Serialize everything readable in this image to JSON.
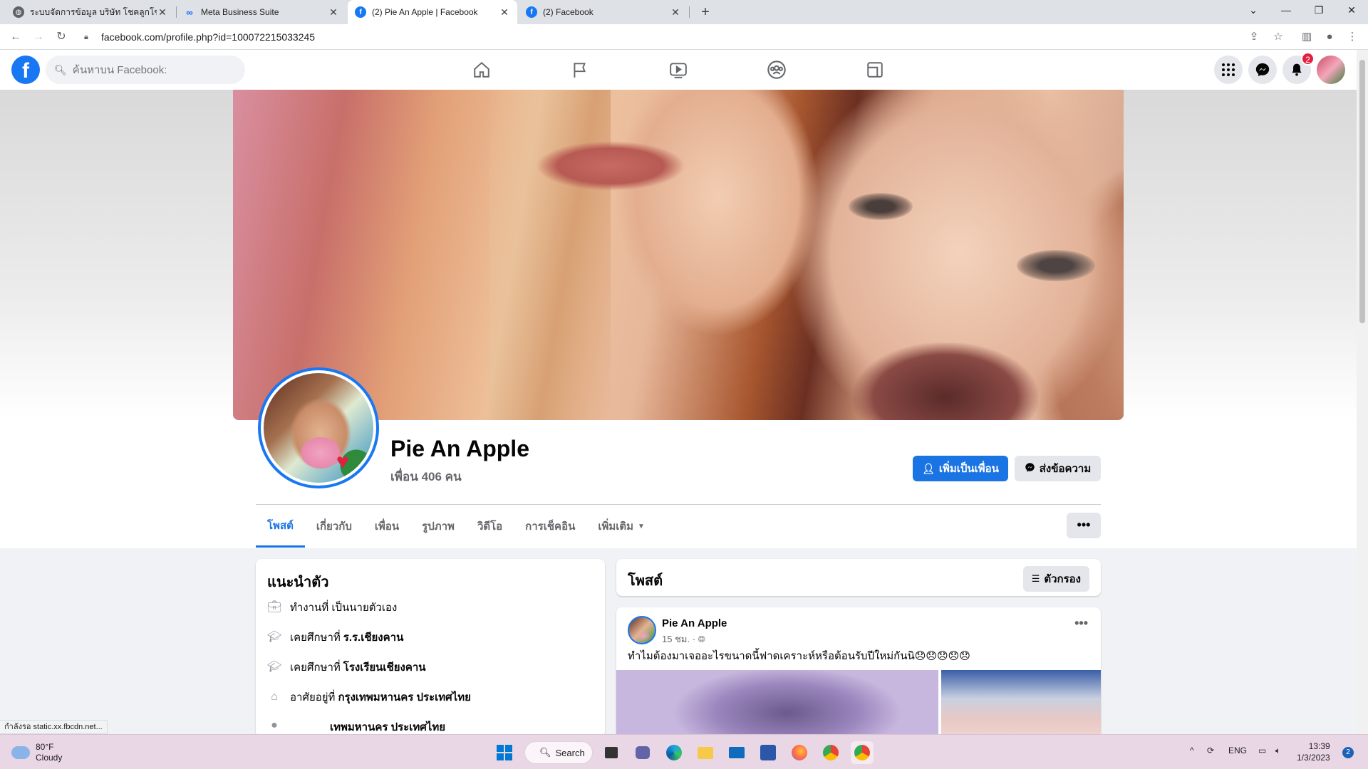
{
  "browser": {
    "tabs": [
      {
        "title": "ระบบจัดการข้อมูล บริษัท โชคลูกโชต"
      },
      {
        "title": "Meta Business Suite"
      },
      {
        "title": "(2) Pie An Apple | Facebook"
      },
      {
        "title": "(2) Facebook"
      }
    ],
    "url": "facebook.com/profile.php?id=100072215033245",
    "status_text": "กำลังรอ static.xx.fbcdn.net..."
  },
  "fb_nav": {
    "logo": "f",
    "search_placeholder": "ค้นหาบน Facebook:",
    "notification_count": "2",
    "icons": [
      "home-icon",
      "flag-icon",
      "watch-icon",
      "groups-icon",
      "gaming-icon"
    ]
  },
  "profile": {
    "name": "Pie An Apple",
    "friends": "เพื่อน 406 คน",
    "add_friend_label": "เพิ่มเป็นเพื่อน",
    "message_label": "ส่งข้อความ",
    "more_label": "•••",
    "tabs": [
      {
        "label": "โพสต์",
        "active": true
      },
      {
        "label": "เกี่ยวกับ"
      },
      {
        "label": "เพื่อน"
      },
      {
        "label": "รูปภาพ"
      },
      {
        "label": "วิดีโอ"
      },
      {
        "label": "การเช็คอิน"
      },
      {
        "label": "เพิ่มเติม"
      }
    ]
  },
  "intro": {
    "title": "แนะนำตัว",
    "items": [
      {
        "prefix": "ทำงานที่ เป็นนายตัวเอง",
        "bold": "",
        "icon": "briefcase-icon"
      },
      {
        "prefix": "เคยศึกษาที่",
        "bold": "ร.ร.เชียงคาน",
        "icon": "graduation-cap-icon"
      },
      {
        "prefix": "เคยศึกษาที่",
        "bold": "โรงเรียนเชียงคาน",
        "icon": "graduation-cap-icon"
      },
      {
        "prefix": "อาศัยอยู่ที่",
        "bold": "กรุงเทพมหานคร ประเทศไทย",
        "icon": "house-icon"
      },
      {
        "prefix": "",
        "bold": "เทพมหานคร ประเทศไทย",
        "icon": "location-icon"
      }
    ]
  },
  "posts": {
    "title": "โพสต์",
    "filter_label": "ตัวกรอง",
    "items": [
      {
        "author": "Pie An Apple",
        "time": "15 ชม. · ",
        "text": "ทำไมต้องมาเจออะไรขนาดนี้ฟาดเคราะห์หรือต้อนรับปีใหม่กันนิ😞😞😞😞😞"
      }
    ]
  },
  "taskbar": {
    "weather_temp": "80°F",
    "weather_desc": "Cloudy",
    "search_label": "Search",
    "lang": "ENG",
    "time": "13:39",
    "date": "1/3/2023",
    "notif_badge": "2"
  },
  "colors": {
    "fb_blue": "#1877f2",
    "button_blue": "#1b74e4",
    "badge_red": "#e41e3f"
  }
}
